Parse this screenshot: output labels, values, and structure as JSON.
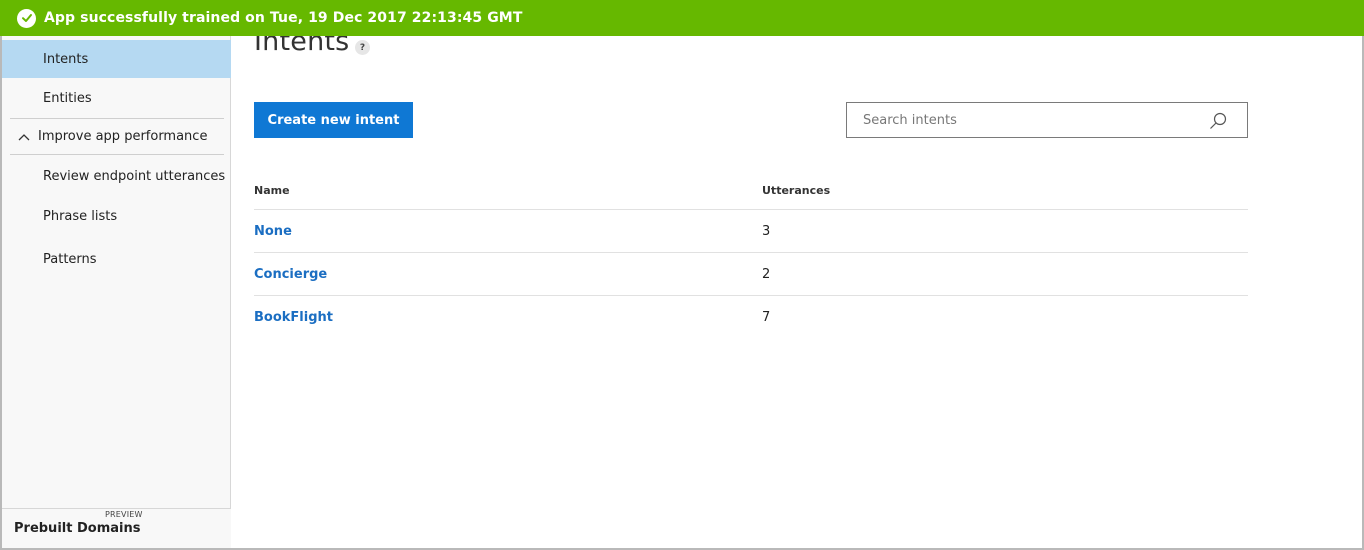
{
  "notification": {
    "message": "App successfully trained on Tue, 19 Dec 2017 22:13:45 GMT",
    "icon": "checkmark-icon",
    "color": "#66b800"
  },
  "sidebar": {
    "items": [
      {
        "label": "Intents",
        "active": true
      },
      {
        "label": "Entities",
        "active": false
      }
    ],
    "section": {
      "label": "Improve app performance",
      "icon": "chevron-up-icon"
    },
    "section_items": [
      {
        "label": "Review endpoint utterances"
      },
      {
        "label": "Phrase lists"
      },
      {
        "label": "Patterns"
      }
    ],
    "bottom": {
      "label": "Prebuilt Domains",
      "badge": "PREVIEW"
    }
  },
  "main": {
    "title": "Intents",
    "help_icon": "?",
    "create_button": "Create new intent",
    "search": {
      "placeholder": "Search intents",
      "value": ""
    },
    "table": {
      "columns": [
        "Name",
        "Utterances"
      ],
      "rows": [
        {
          "name": "None",
          "utterances": "3"
        },
        {
          "name": "Concierge",
          "utterances": "2"
        },
        {
          "name": "BookFlight",
          "utterances": "7"
        }
      ]
    }
  },
  "colors": {
    "accent": "#0f78d4",
    "link": "#1b6ec2",
    "active_nav": "#b5d9f2"
  }
}
